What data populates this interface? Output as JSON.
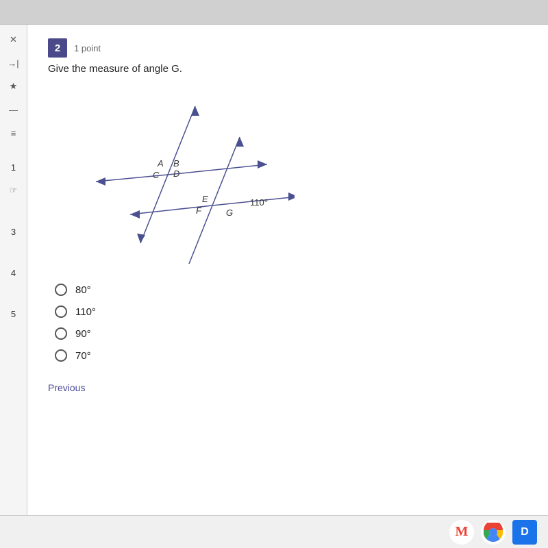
{
  "browser": {
    "bar_bg": "#d0d0d0"
  },
  "sidebar": {
    "icons": [
      "×",
      "→|",
      "★",
      "—",
      "≡"
    ],
    "numbers": [
      "1",
      "3",
      "4",
      "5"
    ],
    "hand_icon": "☞"
  },
  "question": {
    "number": "2",
    "points": "1 point",
    "text": "Give the measure of angle G.",
    "diagram": {
      "angle_label": "110°",
      "labels": [
        "A",
        "B",
        "C",
        "D",
        "E",
        "F",
        "G"
      ]
    },
    "choices": [
      {
        "id": "a",
        "label": "80°"
      },
      {
        "id": "b",
        "label": "110°"
      },
      {
        "id": "c",
        "label": "90°"
      },
      {
        "id": "d",
        "label": "70°"
      }
    ]
  },
  "nav": {
    "previous_label": "Previous"
  },
  "taskbar": {
    "icons": [
      "M",
      "⬤",
      "D"
    ]
  }
}
